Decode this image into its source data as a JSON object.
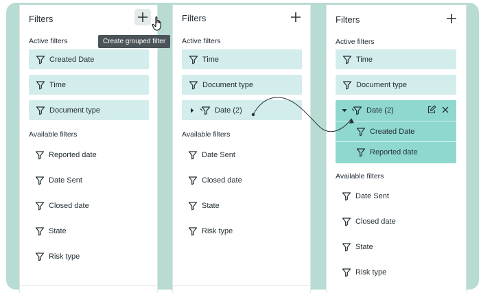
{
  "panels": [
    {
      "title": "Filters",
      "add_tooltip": "Create grouped filter",
      "active_label": "Active filters",
      "active": [
        "Created Date",
        "Time",
        "Document type"
      ],
      "available_label": "Available filters",
      "available": [
        "Reported date",
        "Date Sent",
        "Closed date",
        "State",
        "Risk type"
      ]
    },
    {
      "title": "Filters",
      "active_label": "Active filters",
      "active": [
        "Time",
        "Document type"
      ],
      "dragging": "Date (2)",
      "available_label": "Available filters",
      "available": [
        "Date Sent",
        "Closed date",
        "State",
        "Risk type"
      ]
    },
    {
      "title": "Filters",
      "active_label": "Active filters",
      "active": [
        "Time",
        "Document type"
      ],
      "group": {
        "label": "Date (2)",
        "children": [
          "Created Date",
          "Reported date"
        ]
      },
      "available_label": "Available filters",
      "available": [
        "Date Sent",
        "Closed date",
        "State",
        "Risk type"
      ]
    }
  ],
  "icons": {
    "filter": "filter-icon",
    "grouped_filter": "grouped-filter-icon",
    "plus": "plus-icon",
    "edit": "edit-icon",
    "close": "close-icon",
    "caret_right": "caret-right-icon",
    "caret_down": "caret-down-icon",
    "cursor": "hand-cursor-icon"
  },
  "colors": {
    "frame_bg": "#b8dbd3",
    "chip_bg": "#d3ecec",
    "group_bg": "#8ed8d0",
    "tooltip_bg": "#4b5458"
  }
}
